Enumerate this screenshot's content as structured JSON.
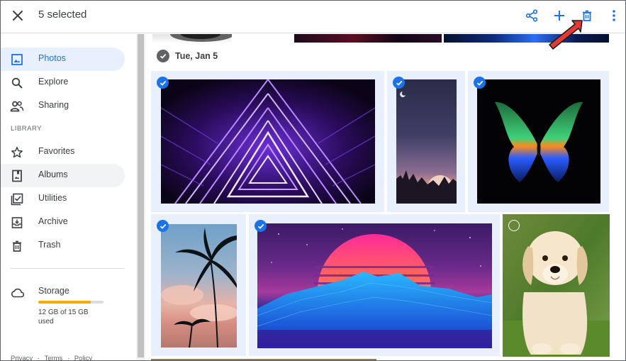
{
  "header": {
    "selection_text": "5 selected",
    "actions": [
      "share-icon",
      "add-icon",
      "delete-icon",
      "more-vert-icon"
    ]
  },
  "sidebar": {
    "items": [
      {
        "label": "Photos",
        "icon": "photos-icon",
        "active": true
      },
      {
        "label": "Explore",
        "icon": "search-icon"
      },
      {
        "label": "Sharing",
        "icon": "people-icon"
      }
    ],
    "library_heading": "LIBRARY",
    "library_items": [
      {
        "label": "Favorites",
        "icon": "star-icon"
      },
      {
        "label": "Albums",
        "icon": "album-icon",
        "hovered": true
      },
      {
        "label": "Utilities",
        "icon": "utilities-icon"
      },
      {
        "label": "Archive",
        "icon": "archive-icon"
      },
      {
        "label": "Trash",
        "icon": "trash-icon"
      }
    ],
    "storage": {
      "label": "Storage",
      "text": "12 GB of 15 GB used",
      "used_fraction": 0.8
    },
    "footer": [
      "Privacy",
      "·",
      "Terms",
      "·",
      "Policy"
    ]
  },
  "content": {
    "date_group": "Tue, Jan 5",
    "selected_count": 5,
    "photos": [
      {
        "name": "neon-triangle-tunnel",
        "selected": true
      },
      {
        "name": "night-sky-moonrise",
        "selected": true
      },
      {
        "name": "neon-butterfly",
        "selected": true
      },
      {
        "name": "palm-trees-sunset",
        "selected": true
      },
      {
        "name": "synthwave-mountain-sun",
        "selected": true
      },
      {
        "name": "puppy",
        "selected": false
      }
    ]
  },
  "colors": {
    "accent": "#1a73e8",
    "active_bg": "#e8f0fe",
    "storage_fill": "#f9ab00",
    "annotation_arrow": "#e53935"
  }
}
